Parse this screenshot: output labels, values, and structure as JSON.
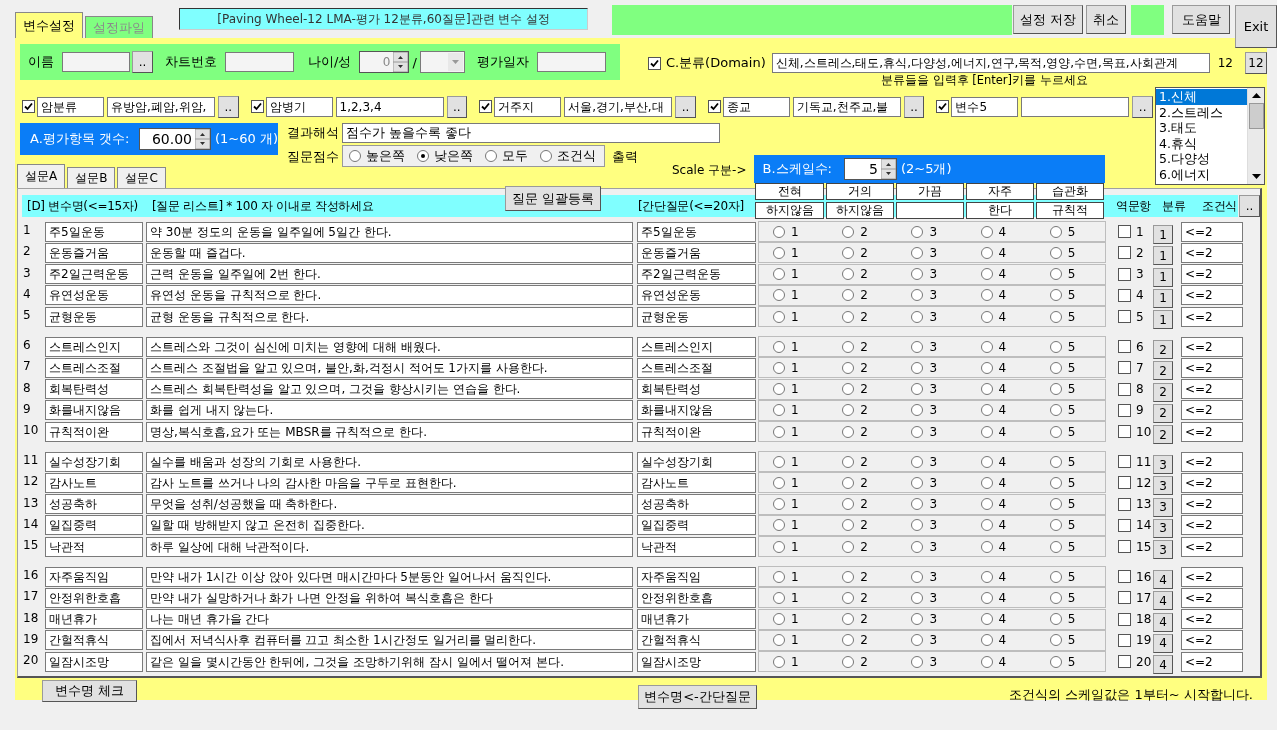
{
  "tabs": [
    {
      "label": "변수설정",
      "selected": true
    },
    {
      "label": "설정파일",
      "selected": false
    }
  ],
  "title": "[Paving Wheel-12 LMA-평가 12분류,60질문]관련 변수 설정",
  "toolbar_buttons": [
    "설정 저장",
    "취소"
  ],
  "help_button": "도움말",
  "exit_button": "Exit",
  "patient": {
    "name_label": "이름",
    "name_button": "..",
    "chart_label": "차트번호",
    "age_sex_label": "나이/성",
    "age_value": "0",
    "separator": "/",
    "date_label": "평가일자"
  },
  "domain": {
    "checked": true,
    "label": "C.분류(Domain)",
    "value": "신체,스트레스,태도,휴식,다양성,에너지,연구,목적,영양,수면,목표,사회관계",
    "count": "12",
    "count_button": "12",
    "hint": "분류들을 입력후 [Enter]키를 누르세요"
  },
  "variables": [
    {
      "checked": true,
      "name": "암분류",
      "value": "유방암,폐암,위암,",
      "button": ".."
    },
    {
      "checked": true,
      "name": "암병기",
      "value": "1,2,3,4",
      "button": ".."
    },
    {
      "checked": true,
      "name": "거주지",
      "value": "서울,경기,부산,대",
      "button": ".."
    },
    {
      "checked": true,
      "name": "종교",
      "value": "기독교,천주교,불",
      "button": ".."
    },
    {
      "checked": true,
      "name": "변수5",
      "button": ".."
    }
  ],
  "domain_list": {
    "items": [
      {
        "label": "1.신체",
        "selected": true
      },
      {
        "label": "2.스트레스",
        "selected": false
      },
      {
        "label": "3.태도",
        "selected": false
      },
      {
        "label": "4.휴식",
        "selected": false
      },
      {
        "label": "5.다양성",
        "selected": false
      },
      {
        "label": "6.에너지",
        "selected": false
      }
    ]
  },
  "item_count": {
    "label": "A.평가항목 갯수:",
    "value": "60.00",
    "range": "(1~60 개)"
  },
  "interpretation": {
    "label": "결과해석",
    "value": "점수가 높을수록 좋다"
  },
  "question_score": {
    "label": "질문점수",
    "options": [
      {
        "label": "높은쪽",
        "selected": false
      },
      {
        "label": "낮은쪽",
        "selected": true
      },
      {
        "label": "모두",
        "selected": false
      },
      {
        "label": "조건식",
        "selected": false
      }
    ],
    "output_label": "출력"
  },
  "scale": {
    "section_label": "Scale 구분->",
    "label": "B.스케일수:",
    "value": "5",
    "range": "(2~5개)",
    "headers": [
      {
        "line1": "전혀",
        "line2": "하지않음"
      },
      {
        "line1": "거의",
        "line2": "하지않음"
      },
      {
        "line1": "가끔"
      },
      {
        "line1": "자주",
        "line2": "한다"
      },
      {
        "line1": "습관화",
        "line2": "규칙적"
      }
    ]
  },
  "survey_tabs": [
    {
      "label": "설문A",
      "selected": true
    },
    {
      "label": "설문B",
      "selected": false
    },
    {
      "label": "설문C",
      "selected": false
    }
  ],
  "bulk_button": "질문 일괄등록",
  "table": {
    "columns": {
      "name": "[D] 변수명(<=15자)",
      "question": "[질문 리스트] * 100 자 이내로 작성하세요",
      "short": "[간단질문(<=20자]",
      "reverse": "역문항",
      "category": "분류",
      "condition": "조건식"
    },
    "more_button": "..",
    "groups": [
      {
        "rows": [
          {
            "number": "1",
            "name": "주5일운동",
            "question": "약 30분 정도의 운동을 일주일에 5일간 한다.",
            "short": "주5일운동",
            "options": [
              {
                "label": "1",
                "selected": false
              },
              {
                "label": "2",
                "selected": false
              },
              {
                "label": "3",
                "selected": false
              },
              {
                "label": "4",
                "selected": false
              },
              {
                "label": "5",
                "selected": false
              }
            ],
            "reverse_checked": false,
            "reverse_label": "1",
            "category": "1",
            "condition": "<=2"
          },
          {
            "number": "2",
            "name": "운동즐거움",
            "question": "운동할 때 즐겁다.",
            "short": "운동즐거움",
            "options": [
              {
                "label": "1",
                "selected": false
              },
              {
                "label": "2",
                "selected": false
              },
              {
                "label": "3",
                "selected": false
              },
              {
                "label": "4",
                "selected": false
              },
              {
                "label": "5",
                "selected": false
              }
            ],
            "reverse_checked": false,
            "reverse_label": "2",
            "category": "1",
            "condition": "<=2"
          },
          {
            "number": "3",
            "name": "주2일근력운동",
            "question": "근력 운동을 일주일에 2번 한다.",
            "short": "주2일근력운동",
            "options": [
              {
                "label": "1",
                "selected": false
              },
              {
                "label": "2",
                "selected": false
              },
              {
                "label": "3",
                "selected": false
              },
              {
                "label": "4",
                "selected": false
              },
              {
                "label": "5",
                "selected": false
              }
            ],
            "reverse_checked": false,
            "reverse_label": "3",
            "category": "1",
            "condition": "<=2"
          },
          {
            "number": "4",
            "name": "유연성운동",
            "question": "유연성 운동을 규칙적으로 한다.",
            "short": "유연성운동",
            "options": [
              {
                "label": "1",
                "selected": false
              },
              {
                "label": "2",
                "selected": false
              },
              {
                "label": "3",
                "selected": false
              },
              {
                "label": "4",
                "selected": false
              },
              {
                "label": "5",
                "selected": false
              }
            ],
            "reverse_checked": false,
            "reverse_label": "4",
            "category": "1",
            "condition": "<=2"
          },
          {
            "number": "5",
            "name": "균형운동",
            "question": "균형 운동을 규칙적으로 한다.",
            "short": "균형운동",
            "options": [
              {
                "label": "1",
                "selected": false
              },
              {
                "label": "2",
                "selected": false
              },
              {
                "label": "3",
                "selected": false
              },
              {
                "label": "4",
                "selected": false
              },
              {
                "label": "5",
                "selected": false
              }
            ],
            "reverse_checked": false,
            "reverse_label": "5",
            "category": "1",
            "condition": "<=2"
          }
        ]
      },
      {
        "rows": [
          {
            "number": "6",
            "name": "스트레스인지",
            "question": "스트레스와 그것이 심신에 미치는 영향에 대해 배웠다.",
            "short": "스트레스인지",
            "options": [
              {
                "label": "1",
                "selected": false
              },
              {
                "label": "2",
                "selected": false
              },
              {
                "label": "3",
                "selected": false
              },
              {
                "label": "4",
                "selected": false
              },
              {
                "label": "5",
                "selected": false
              }
            ],
            "reverse_checked": false,
            "reverse_label": "6",
            "category": "2",
            "condition": "<=2"
          },
          {
            "number": "7",
            "name": "스트레스조절",
            "question": "스트레스 조절법을 알고 있으며, 불안,화,걱정시 적어도 1가지를 사용한다.",
            "short": "스트레스조절",
            "options": [
              {
                "label": "1",
                "selected": false
              },
              {
                "label": "2",
                "selected": false
              },
              {
                "label": "3",
                "selected": false
              },
              {
                "label": "4",
                "selected": false
              },
              {
                "label": "5",
                "selected": false
              }
            ],
            "reverse_checked": false,
            "reverse_label": "7",
            "category": "2",
            "condition": "<=2"
          },
          {
            "number": "8",
            "name": "회복탄력성",
            "question": "스트레스 회복탄력성을 알고 있으며, 그것을 향상시키는 연습을 한다.",
            "short": "회복탄력성",
            "options": [
              {
                "label": "1",
                "selected": false
              },
              {
                "label": "2",
                "selected": false
              },
              {
                "label": "3",
                "selected": false
              },
              {
                "label": "4",
                "selected": false
              },
              {
                "label": "5",
                "selected": false
              }
            ],
            "reverse_checked": false,
            "reverse_label": "8",
            "category": "2",
            "condition": "<=2"
          },
          {
            "number": "9",
            "name": "화를내지않음",
            "question": "화를 쉽게 내지 않는다.",
            "short": "화를내지않음",
            "options": [
              {
                "label": "1",
                "selected": false
              },
              {
                "label": "2",
                "selected": false
              },
              {
                "label": "3",
                "selected": false
              },
              {
                "label": "4",
                "selected": false
              },
              {
                "label": "5",
                "selected": false
              }
            ],
            "reverse_checked": false,
            "reverse_label": "9",
            "category": "2",
            "condition": "<=2"
          },
          {
            "number": "10",
            "name": "규칙적이완",
            "question": "명상,복식호흡,요가 또는 MBSR를 규칙적으로 한다.",
            "short": "규칙적이완",
            "options": [
              {
                "label": "1",
                "selected": false
              },
              {
                "label": "2",
                "selected": false
              },
              {
                "label": "3",
                "selected": false
              },
              {
                "label": "4",
                "selected": false
              },
              {
                "label": "5",
                "selected": false
              }
            ],
            "reverse_checked": false,
            "reverse_label": "10",
            "category": "2",
            "condition": "<=2"
          }
        ]
      },
      {
        "rows": [
          {
            "number": "11",
            "name": "실수성장기회",
            "question": "실수를 배움과 성장의 기회로 사용한다.",
            "short": "실수성장기회",
            "options": [
              {
                "label": "1",
                "selected": false
              },
              {
                "label": "2",
                "selected": false
              },
              {
                "label": "3",
                "selected": false
              },
              {
                "label": "4",
                "selected": false
              },
              {
                "label": "5",
                "selected": false
              }
            ],
            "reverse_checked": false,
            "reverse_label": "11",
            "category": "3",
            "condition": "<=2"
          },
          {
            "number": "12",
            "name": "감사노트",
            "question": "감사 노트를 쓰거나 나의 감사한 마음을 구두로 표현한다.",
            "short": "감사노트",
            "options": [
              {
                "label": "1",
                "selected": false
              },
              {
                "label": "2",
                "selected": false
              },
              {
                "label": "3",
                "selected": false
              },
              {
                "label": "4",
                "selected": false
              },
              {
                "label": "5",
                "selected": false
              }
            ],
            "reverse_checked": false,
            "reverse_label": "12",
            "category": "3",
            "condition": "<=2"
          },
          {
            "number": "13",
            "name": "성공축하",
            "question": "무엇을 성취/성공했을 때 축하한다.",
            "short": "성공축하",
            "options": [
              {
                "label": "1",
                "selected": false
              },
              {
                "label": "2",
                "selected": false
              },
              {
                "label": "3",
                "selected": false
              },
              {
                "label": "4",
                "selected": false
              },
              {
                "label": "5",
                "selected": false
              }
            ],
            "reverse_checked": false,
            "reverse_label": "13",
            "category": "3",
            "condition": "<=2"
          },
          {
            "number": "14",
            "name": "일집중력",
            "question": "일할 때 방해받지 않고 온전히 집중한다.",
            "short": "일집중력",
            "options": [
              {
                "label": "1",
                "selected": false
              },
              {
                "label": "2",
                "selected": false
              },
              {
                "label": "3",
                "selected": false
              },
              {
                "label": "4",
                "selected": false
              },
              {
                "label": "5",
                "selected": false
              }
            ],
            "reverse_checked": false,
            "reverse_label": "14",
            "category": "3",
            "condition": "<=2"
          },
          {
            "number": "15",
            "name": "낙관적",
            "question": "하루 일상에 대해 낙관적이다.",
            "short": "낙관적",
            "options": [
              {
                "label": "1",
                "selected": false
              },
              {
                "label": "2",
                "selected": false
              },
              {
                "label": "3",
                "selected": false
              },
              {
                "label": "4",
                "selected": false
              },
              {
                "label": "5",
                "selected": false
              }
            ],
            "reverse_checked": false,
            "reverse_label": "15",
            "category": "3",
            "condition": "<=2"
          }
        ]
      },
      {
        "rows": [
          {
            "number": "16",
            "name": "자주움직임",
            "question": "만약 내가 1시간 이상 앉아 있다면 매시간마다 5분동안 일어나서 움직인다.",
            "short": "자주움직임",
            "options": [
              {
                "label": "1",
                "selected": false
              },
              {
                "label": "2",
                "selected": false
              },
              {
                "label": "3",
                "selected": false
              },
              {
                "label": "4",
                "selected": false
              },
              {
                "label": "5",
                "selected": false
              }
            ],
            "reverse_checked": false,
            "reverse_label": "16",
            "category": "4",
            "condition": "<=2"
          },
          {
            "number": "17",
            "name": "안정위한호흡",
            "question": "만약 내가 실망하거나 화가 나면 안정을 위하여 복식호흡은 한다",
            "short": "안정위한호흡",
            "options": [
              {
                "label": "1",
                "selected": false
              },
              {
                "label": "2",
                "selected": false
              },
              {
                "label": "3",
                "selected": false
              },
              {
                "label": "4",
                "selected": false
              },
              {
                "label": "5",
                "selected": false
              }
            ],
            "reverse_checked": false,
            "reverse_label": "17",
            "category": "4",
            "condition": "<=2"
          },
          {
            "number": "18",
            "name": "매년휴가",
            "question": "나는 매년 휴가을 간다",
            "short": "매년휴가",
            "options": [
              {
                "label": "1",
                "selected": false
              },
              {
                "label": "2",
                "selected": false
              },
              {
                "label": "3",
                "selected": false
              },
              {
                "label": "4",
                "selected": false
              },
              {
                "label": "5",
                "selected": false
              }
            ],
            "reverse_checked": false,
            "reverse_label": "18",
            "category": "4",
            "condition": "<=2"
          },
          {
            "number": "19",
            "name": "간헐적휴식",
            "question": "집에서 저녁식사후 컴퓨터를 끄고 최소한 1시간정도 일거리를 멀리한다.",
            "short": "간헐적휴식",
            "options": [
              {
                "label": "1",
                "selected": false
              },
              {
                "label": "2",
                "selected": false
              },
              {
                "label": "3",
                "selected": false
              },
              {
                "label": "4",
                "selected": false
              },
              {
                "label": "5",
                "selected": false
              }
            ],
            "reverse_checked": false,
            "reverse_label": "19",
            "category": "4",
            "condition": "<=2"
          },
          {
            "number": "20",
            "name": "일잠시조망",
            "question": "같은 일을 몇시간동안 한뒤에, 그것을 조망하기위해 잠시 일에서 떨어져 본다.",
            "short": "일잠시조망",
            "options": [
              {
                "label": "1",
                "selected": false
              },
              {
                "label": "2",
                "selected": false
              },
              {
                "label": "3",
                "selected": false
              },
              {
                "label": "4",
                "selected": false
              },
              {
                "label": "5",
                "selected": false
              }
            ],
            "reverse_checked": false,
            "reverse_label": "20",
            "category": "4",
            "condition": "<=2"
          }
        ]
      }
    ]
  },
  "check_button": "변수명 체크",
  "copy_button": "변수명<-간단질문",
  "note": "조건식의 스케일값은 1부터~ 시작합니다."
}
